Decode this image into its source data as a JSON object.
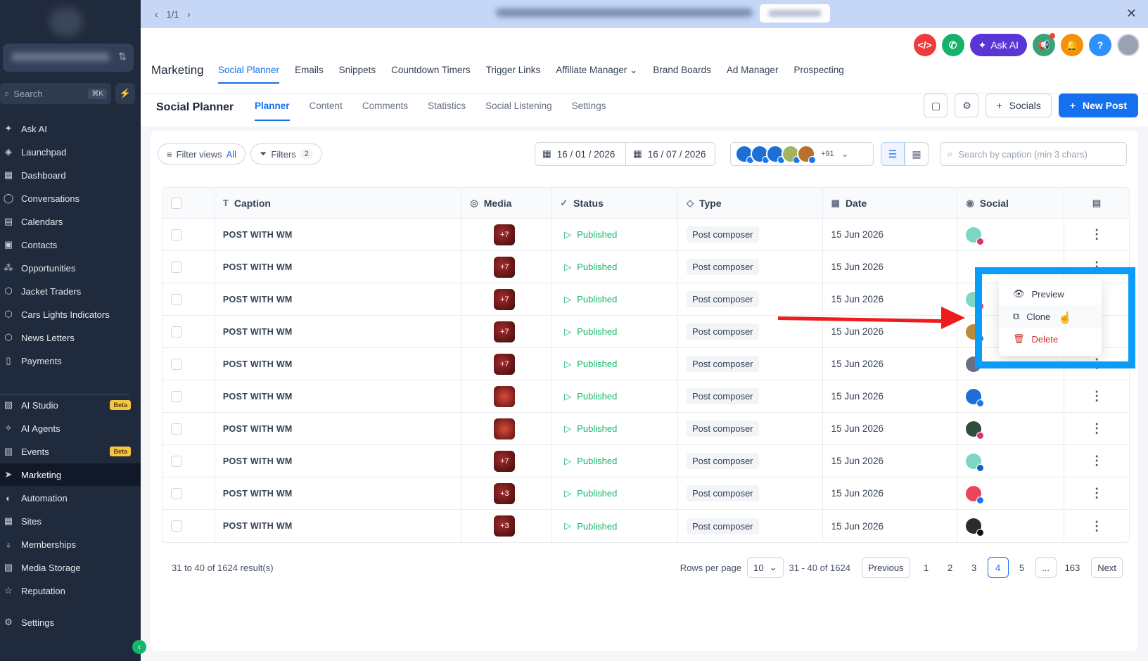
{
  "banner": {
    "pager": "1/1"
  },
  "sidebar": {
    "search_placeholder": "Search",
    "search_shortcut": "⌘K",
    "items": [
      {
        "label": "Ask AI",
        "icon": "sparkle-icon",
        "badge": ""
      },
      {
        "label": "Launchpad",
        "icon": "rocket-icon",
        "badge": ""
      },
      {
        "label": "Dashboard",
        "icon": "dashboard-icon",
        "badge": ""
      },
      {
        "label": "Conversations",
        "icon": "chat-icon",
        "badge": ""
      },
      {
        "label": "Calendars",
        "icon": "calendar-icon",
        "badge": ""
      },
      {
        "label": "Contacts",
        "icon": "contacts-icon",
        "badge": ""
      },
      {
        "label": "Opportunities",
        "icon": "opportunities-icon",
        "badge": ""
      },
      {
        "label": "Jacket Traders",
        "icon": "cube-icon",
        "badge": ""
      },
      {
        "label": "Cars Lights Indicators",
        "icon": "cube-icon",
        "badge": ""
      },
      {
        "label": "News Letters",
        "icon": "cube-icon",
        "badge": ""
      },
      {
        "label": "Payments",
        "icon": "payments-icon",
        "badge": ""
      },
      {
        "label": "AI Studio",
        "icon": "ai-studio-icon",
        "badge": "Beta"
      },
      {
        "label": "AI Agents",
        "icon": "ai-agents-icon",
        "badge": ""
      },
      {
        "label": "Events",
        "icon": "events-icon",
        "badge": "Beta"
      },
      {
        "label": "Marketing",
        "icon": "marketing-icon",
        "badge": ""
      },
      {
        "label": "Automation",
        "icon": "automation-icon",
        "badge": ""
      },
      {
        "label": "Sites",
        "icon": "sites-icon",
        "badge": ""
      },
      {
        "label": "Memberships",
        "icon": "memberships-icon",
        "badge": ""
      },
      {
        "label": "Media Storage",
        "icon": "media-icon",
        "badge": ""
      },
      {
        "label": "Reputation",
        "icon": "star-icon",
        "badge": ""
      },
      {
        "label": "Settings",
        "icon": "gear-icon",
        "badge": ""
      }
    ],
    "active": "Marketing"
  },
  "header": {
    "ask_ai_label": "Ask AI",
    "title": "Marketing",
    "tabs": [
      "Social Planner",
      "Emails",
      "Snippets",
      "Countdown Timers",
      "Trigger Links",
      "Affiliate Manager",
      "Brand Boards",
      "Ad Manager",
      "Prospecting"
    ],
    "active_tab": "Social Planner"
  },
  "subheader": {
    "title": "Social Planner",
    "tabs": [
      "Planner",
      "Content",
      "Comments",
      "Statistics",
      "Social Listening",
      "Settings"
    ],
    "active_tab": "Planner",
    "socials_label": "Socials",
    "new_post_label": "New Post"
  },
  "filters": {
    "filter_views_label": "Filter views",
    "filter_views_value": "All",
    "filters_label": "Filters",
    "filters_count": "2",
    "date_from": "16 / 01 / 2026",
    "date_to": "16 / 07 / 2026",
    "accounts_more": "+91",
    "search_placeholder": "Search by caption (min 3 chars)"
  },
  "table": {
    "headers": [
      "Caption",
      "Media",
      "Status",
      "Type",
      "Date",
      "Social"
    ],
    "rows": [
      {
        "caption": "POST WITH WM",
        "media": "+7",
        "status": "Published",
        "type": "Post composer",
        "date": "15 Jun 2026",
        "social_color": "#7ed6c4",
        "social_net": "#e1306c"
      },
      {
        "caption": "POST WITH WM",
        "media": "+7",
        "status": "Published",
        "type": "Post composer",
        "date": "15 Jun 2026",
        "social_color": "#ffffff",
        "social_net": ""
      },
      {
        "caption": "POST WITH WM",
        "media": "+7",
        "status": "Published",
        "type": "Post composer",
        "date": "15 Jun 2026",
        "social_color": "#7ed6c4",
        "social_net": "#e1306c"
      },
      {
        "caption": "POST WITH WM",
        "media": "+7",
        "status": "Published",
        "type": "Post composer",
        "date": "15 Jun 2026",
        "social_color": "#b98a3a",
        "social_net": "#1877f2"
      },
      {
        "caption": "POST WITH WM",
        "media": "+7",
        "status": "Published",
        "type": "Post composer",
        "date": "15 Jun 2026",
        "social_color": "#667085",
        "social_net": ""
      },
      {
        "caption": "POST WITH WM",
        "media": "",
        "status": "Published",
        "type": "Post composer",
        "date": "15 Jun 2026",
        "social_color": "#1d6fd6",
        "social_net": "#1877f2"
      },
      {
        "caption": "POST WITH WM",
        "media": "",
        "status": "Published",
        "type": "Post composer",
        "date": "15 Jun 2026",
        "social_color": "#2f4d3a",
        "social_net": "#e1306c"
      },
      {
        "caption": "POST WITH WM",
        "media": "+7",
        "status": "Published",
        "type": "Post composer",
        "date": "15 Jun 2026",
        "social_color": "#7ed6c4",
        "social_net": "#0a66c2"
      },
      {
        "caption": "POST WITH WM",
        "media": "+3",
        "status": "Published",
        "type": "Post composer",
        "date": "15 Jun 2026",
        "social_color": "#e8465a",
        "social_net": "#1877f2"
      },
      {
        "caption": "POST WITH WM",
        "media": "+3",
        "status": "Published",
        "type": "Post composer",
        "date": "15 Jun 2026",
        "social_color": "#2b2b2b",
        "social_net": "#111111"
      }
    ]
  },
  "context_menu": {
    "items": [
      "Preview",
      "Clone",
      "Delete"
    ]
  },
  "footer": {
    "results": "31 to 40 of 1624 result(s)",
    "rows_per_page_label": "Rows per page",
    "rows_per_page": "10",
    "range": "31 - 40 of 1624",
    "previous": "Previous",
    "pages": [
      "1",
      "2",
      "3",
      "4",
      "5",
      "...",
      "163"
    ],
    "current_page": "4",
    "next": "Next"
  },
  "colors": {
    "primary": "#1570ef",
    "success": "#12b76a",
    "sidebar_bg": "#1f2a3c",
    "annotation_box": "#0a9cf7",
    "annotation_arrow": "#ee1c1c"
  }
}
